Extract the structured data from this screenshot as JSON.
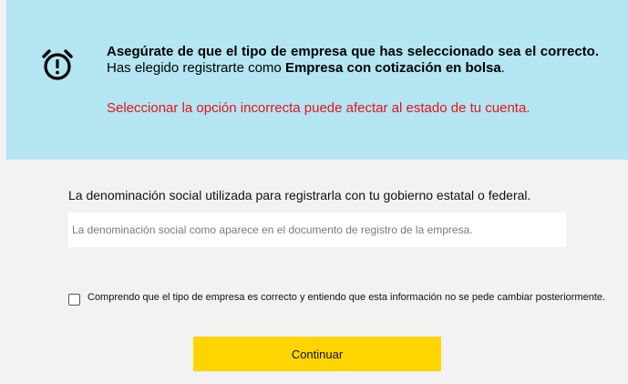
{
  "alert": {
    "icon": "alarm-clock-icon",
    "background_color": "#b3e5f2",
    "title_bold": "Asegúrate de que el tipo de empresa que has seleccionado sea el correcto.",
    "body_text": " Has elegido registrarte como ",
    "selected_type": "Empresa con cotización en bolsa",
    "period": ".",
    "warning": "Seleccionar la opción incorrecta puede afectar al estado de tu cuenta.",
    "warning_color": "#e8121a"
  },
  "form": {
    "legal_name_label": "La denominación social utilizada para registrarla con tu gobierno estatal o federal.",
    "legal_name_value": "",
    "legal_name_placeholder": "La denominación social como aparece en el documento de registro de la empresa.",
    "confirm_checkbox_checked": false,
    "confirm_label": "Comprendo que el tipo de empresa es correcto y entiendo que esta información no se pede cambiar posteriormente.",
    "continue_label": "Continuar",
    "continue_color": "#ffd400"
  }
}
